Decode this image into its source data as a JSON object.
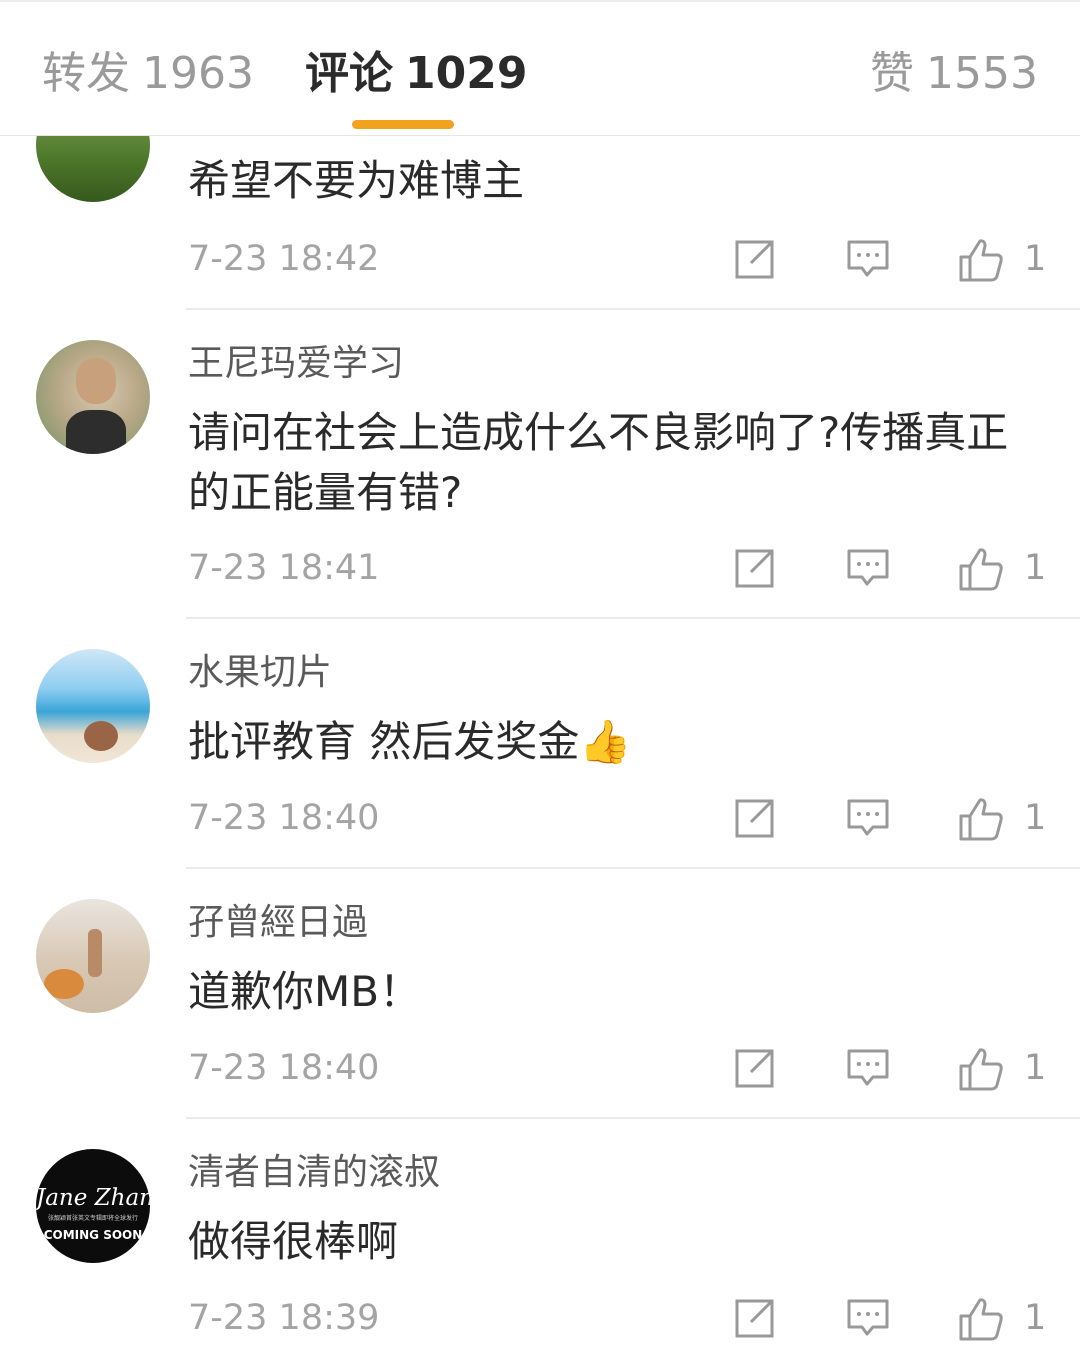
{
  "tabs": {
    "repost": {
      "label": "转发",
      "count": "1963"
    },
    "comments": {
      "label": "评论",
      "count": "1029"
    },
    "likes": {
      "label": "赞",
      "count": "1553"
    }
  },
  "colors": {
    "accent": "#f2a21c",
    "text": "#2a2a2a",
    "muted": "#a4a4a4"
  },
  "comments": [
    {
      "username": "",
      "text": "希望不要为难博主",
      "time": "7-23 18:42",
      "likes": "1",
      "avatar": "green-grass"
    },
    {
      "username": "王尼玛爱学习",
      "text": "请问在社会上造成什么不良影响了?传播真正的正能量有错?",
      "time": "7-23 18:41",
      "likes": "1",
      "avatar": "man-with-camera"
    },
    {
      "username": "水果切片",
      "text": "批评教育 然后发奖金",
      "emoji": "👍",
      "time": "7-23 18:40",
      "likes": "1",
      "avatar": "beach"
    },
    {
      "username": "孖曾經日過",
      "text": "道歉你MB！",
      "time": "7-23 18:40",
      "likes": "1",
      "avatar": "life-of-pi"
    },
    {
      "username": "清者自清的滚叔",
      "text": "做得很棒啊",
      "time": "7-23 18:39",
      "likes": "1",
      "avatar": "jane-zhang-poster",
      "avatar_text": {
        "script": "Jane Zhang",
        "tiny": "张靓颖首张英文专辑即将全球发行",
        "soon": "COMING SOON"
      }
    }
  ],
  "icons": {
    "repost": "repost-icon",
    "comment": "comment-icon",
    "like": "thumbs-up-icon"
  }
}
